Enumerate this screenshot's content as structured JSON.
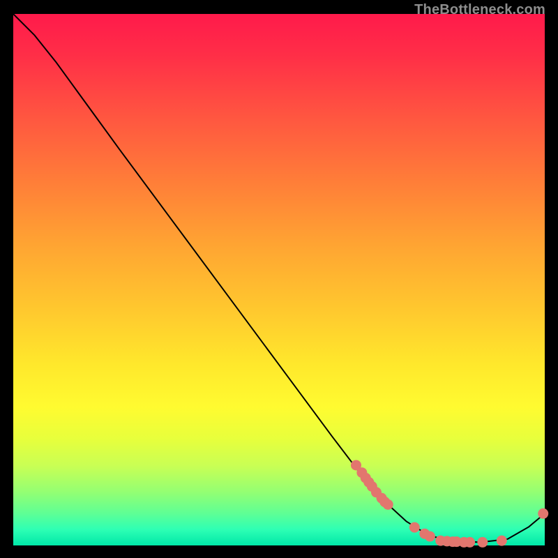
{
  "watermark": "TheBottleneck.com",
  "chart_data": {
    "type": "line",
    "title": "",
    "xlabel": "",
    "ylabel": "",
    "x_range": [
      0,
      100
    ],
    "y_range": [
      0,
      100
    ],
    "curve": [
      {
        "x": 0,
        "y": 100
      },
      {
        "x": 4,
        "y": 96
      },
      {
        "x": 8,
        "y": 91
      },
      {
        "x": 12,
        "y": 85.5
      },
      {
        "x": 20,
        "y": 74.5
      },
      {
        "x": 30,
        "y": 61
      },
      {
        "x": 40,
        "y": 47.5
      },
      {
        "x": 50,
        "y": 34
      },
      {
        "x": 60,
        "y": 20.5
      },
      {
        "x": 68,
        "y": 10
      },
      {
        "x": 74,
        "y": 4.5
      },
      {
        "x": 78,
        "y": 2
      },
      {
        "x": 82,
        "y": 0.8
      },
      {
        "x": 88,
        "y": 0.6
      },
      {
        "x": 93,
        "y": 1.2
      },
      {
        "x": 97,
        "y": 3.5
      },
      {
        "x": 100,
        "y": 6
      }
    ],
    "dot_clusters": [
      {
        "cx": 64.5,
        "cy": 15.1
      },
      {
        "cx": 65.6,
        "cy": 13.7
      },
      {
        "cx": 66.3,
        "cy": 12.7
      },
      {
        "cx": 66.9,
        "cy": 11.9
      },
      {
        "cx": 67.5,
        "cy": 11.1
      },
      {
        "cx": 68.3,
        "cy": 10.0
      },
      {
        "cx": 69.3,
        "cy": 8.9
      },
      {
        "cx": 69.9,
        "cy": 8.2
      },
      {
        "cx": 70.5,
        "cy": 7.7
      },
      {
        "cx": 75.5,
        "cy": 3.4
      },
      {
        "cx": 77.4,
        "cy": 2.2
      },
      {
        "cx": 78.4,
        "cy": 1.7
      },
      {
        "cx": 80.4,
        "cy": 0.9
      },
      {
        "cx": 81.6,
        "cy": 0.8
      },
      {
        "cx": 82.7,
        "cy": 0.7
      },
      {
        "cx": 83.4,
        "cy": 0.7
      },
      {
        "cx": 84.8,
        "cy": 0.6
      },
      {
        "cx": 85.9,
        "cy": 0.6
      },
      {
        "cx": 88.3,
        "cy": 0.6
      },
      {
        "cx": 91.9,
        "cy": 0.9
      },
      {
        "cx": 99.7,
        "cy": 6.0
      }
    ],
    "dot_color": "#e2766e",
    "dot_radius": 7.5
  }
}
